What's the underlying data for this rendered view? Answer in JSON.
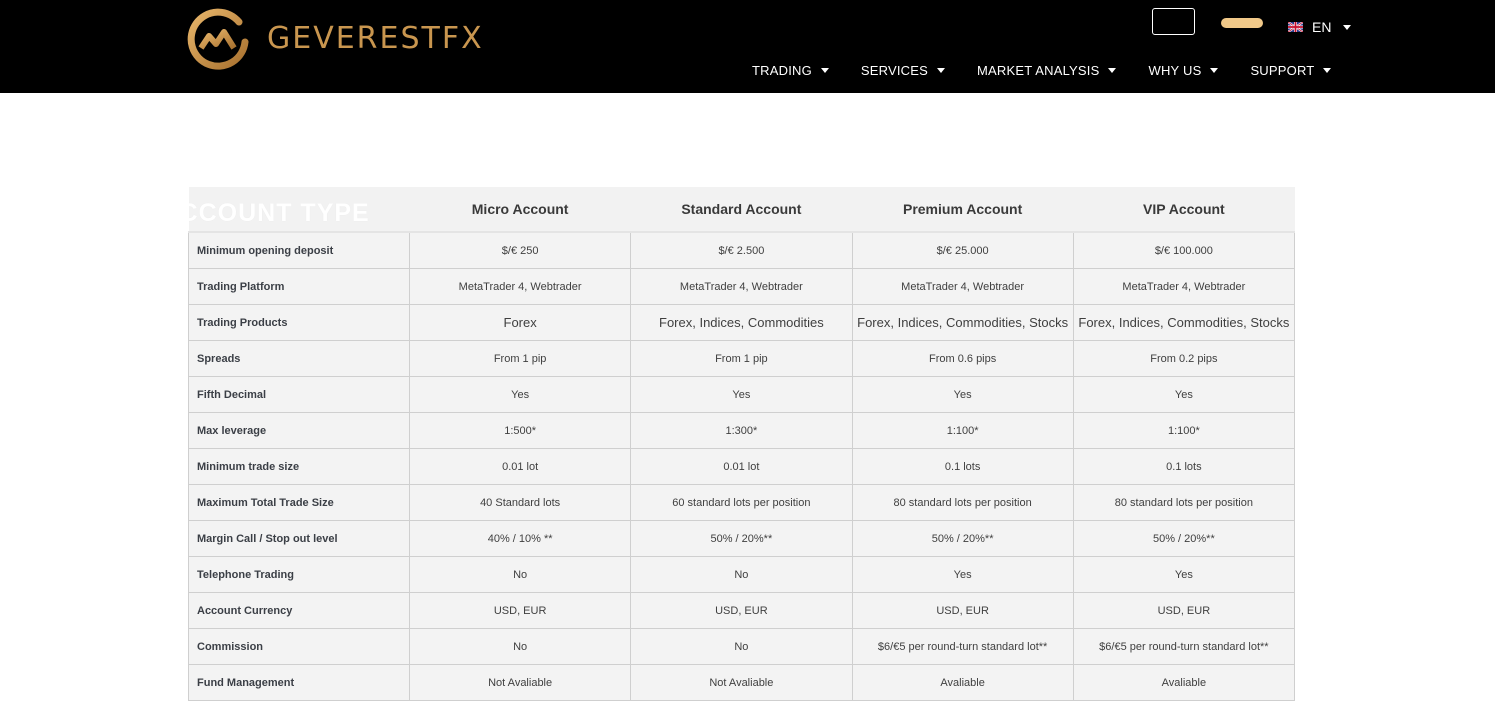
{
  "header": {
    "brand": "GEVERESTFX",
    "brand_color": "#c9964f",
    "language": {
      "label": "EN",
      "flag": "uk-flag-icon"
    },
    "nav": [
      {
        "label": "TRADING"
      },
      {
        "label": "SERVICES"
      },
      {
        "label": "MARKET ANALYSIS"
      },
      {
        "label": "WHY US"
      },
      {
        "label": "SUPPORT"
      }
    ]
  },
  "table": {
    "type_header": "ACCOUNT TYPE",
    "columns": [
      "Micro Account",
      "Standard Account",
      "Premium Account",
      "VIP Account"
    ],
    "rows": [
      {
        "label": "Minimum opening deposit",
        "values": [
          "$/€ 250",
          "$/€ 2.500",
          "$/€ 25.000",
          "$/€ 100.000"
        ]
      },
      {
        "label": "Trading Platform",
        "values": [
          "MetaTrader 4, Webtrader",
          "MetaTrader 4, Webtrader",
          "MetaTrader 4, Webtrader",
          "MetaTrader 4, Webtrader"
        ]
      },
      {
        "label": "Trading Products",
        "values": [
          "Forex",
          "Forex, Indices, Commodities",
          "Forex, Indices, Commodities, Stocks",
          "Forex, Indices, Commodities, Stocks"
        ]
      },
      {
        "label": "Spreads",
        "values": [
          "From 1 pip",
          "From 1 pip",
          "From 0.6 pips",
          "From 0.2 pips"
        ]
      },
      {
        "label": "Fifth Decimal",
        "values": [
          "Yes",
          "Yes",
          "Yes",
          "Yes"
        ]
      },
      {
        "label": "Max leverage",
        "values": [
          "1:500*",
          "1:300*",
          "1:100*",
          "1:100*"
        ]
      },
      {
        "label": "Minimum trade size",
        "values": [
          "0.01 lot",
          "0.01 lot",
          "0.1 lots",
          "0.1 lots"
        ]
      },
      {
        "label": "Maximum Total Trade Size",
        "values": [
          "40 Standard lots",
          "60 standard lots per position",
          "80 standard lots per position",
          "80 standard lots per position"
        ]
      },
      {
        "label": "Margin Call / Stop out level",
        "values": [
          "40% / 10% **",
          "50% / 20%**",
          "50% / 20%**",
          "50% / 20%**"
        ]
      },
      {
        "label": "Telephone Trading",
        "values": [
          "No",
          "No",
          "Yes",
          "Yes"
        ]
      },
      {
        "label": "Account Currency",
        "values": [
          "USD, EUR",
          "USD, EUR",
          "USD, EUR",
          "USD, EUR"
        ]
      },
      {
        "label": "Commission",
        "values": [
          "No",
          "No",
          "$6/€5 per round-turn standard lot**",
          "$6/€5 per round-turn standard lot**"
        ]
      },
      {
        "label": "Fund Management",
        "values": [
          "Not Avaliable",
          "Not Avaliable",
          "Avaliable",
          "Avaliable"
        ]
      }
    ]
  }
}
